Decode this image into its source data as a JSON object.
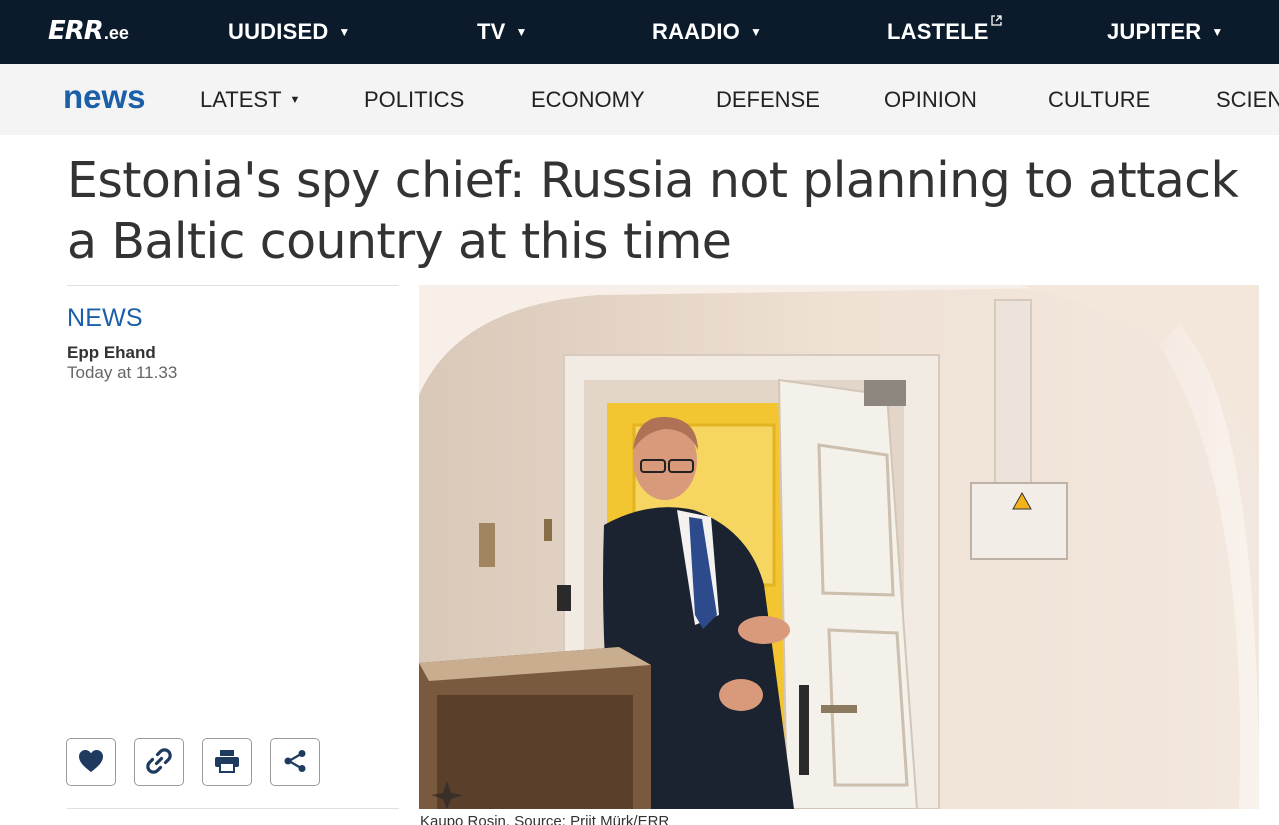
{
  "brand": {
    "logo_main": "ERR",
    "logo_tld": ".ee",
    "section_logo": "news"
  },
  "top_nav": [
    {
      "label": "UUDISED",
      "has_dropdown": true
    },
    {
      "label": "TV",
      "has_dropdown": true
    },
    {
      "label": "RAADIO",
      "has_dropdown": true
    },
    {
      "label": "LASTELE",
      "external": true
    },
    {
      "label": "JUPITER",
      "has_dropdown": true
    }
  ],
  "section_nav": [
    {
      "label": "LATEST",
      "has_dropdown": true
    },
    {
      "label": "POLITICS"
    },
    {
      "label": "ECONOMY"
    },
    {
      "label": "DEFENSE"
    },
    {
      "label": "OPINION"
    },
    {
      "label": "CULTURE"
    },
    {
      "label": "SCIENCE"
    }
  ],
  "article": {
    "headline": "Estonia's spy chief: Russia not planning to attack a Baltic country at this time",
    "category": "NEWS",
    "author": "Epp Ehand",
    "published": "Today at 11.33",
    "caption": "Kaupo Rosin. Source: Priit Mürk/ERR"
  },
  "actions": [
    {
      "icon": "heart-icon"
    },
    {
      "icon": "link-icon"
    },
    {
      "icon": "print-icon"
    },
    {
      "icon": "share-icon"
    }
  ],
  "colors": {
    "topbar_bg": "#0c1b2c",
    "section_bar_bg": "#f4f4f4",
    "accent_blue": "#1a5fa8",
    "door_yellow": "#f2c531"
  }
}
